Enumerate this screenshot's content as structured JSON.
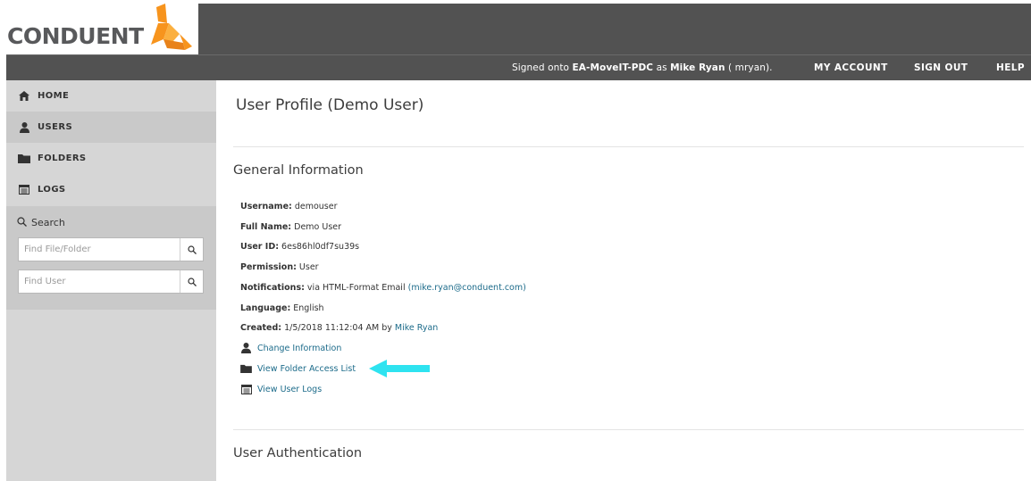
{
  "header": {
    "logo_text": "CONDUENT",
    "signed_prefix": "Signed onto ",
    "site": "EA-MoveIT-PDC",
    "signed_as": " as ",
    "user_name": "Mike Ryan",
    "user_id_suffix": " ( mryan).",
    "my_account": "MY ACCOUNT",
    "sign_out": "SIGN OUT",
    "help": "HELP"
  },
  "sidebar": {
    "items": [
      {
        "label": "HOME",
        "icon": "home-icon"
      },
      {
        "label": "USERS",
        "icon": "user-icon"
      },
      {
        "label": "FOLDERS",
        "icon": "folder-icon"
      },
      {
        "label": "LOGS",
        "icon": "log-icon"
      }
    ],
    "search_title": "Search",
    "find_file_placeholder": "Find File/Folder",
    "find_user_placeholder": "Find User"
  },
  "main": {
    "title": "User Profile (Demo User)",
    "general_title": "General Information",
    "username_label": "Username:",
    "username_value": " demouser",
    "fullname_label": "Full Name:",
    "fullname_value": " Demo User",
    "userid_label": "User ID:",
    "userid_value": " 6es86hl0df7su39s",
    "permission_label": "Permission:",
    "permission_value": " User",
    "notifications_label": "Notifications:",
    "notifications_value": "  via HTML-Format Email ",
    "notifications_email": "(mike.ryan@conduent.com)",
    "language_label": "Language:",
    "language_value": "  English",
    "created_label": "Created:",
    "created_value": "  1/5/2018 11:12:04 AM by ",
    "created_by": "Mike Ryan",
    "action_change": "Change Information",
    "action_folders": "View Folder Access List",
    "action_logs": "View User Logs",
    "auth_title": "User Authentication"
  },
  "colors": {
    "header_bg": "#525252",
    "sidebar_bg": "#d6d6d6",
    "link": "#1c6b8a",
    "arrow": "#2ee3f0",
    "logo_orange": "#f7941d"
  }
}
